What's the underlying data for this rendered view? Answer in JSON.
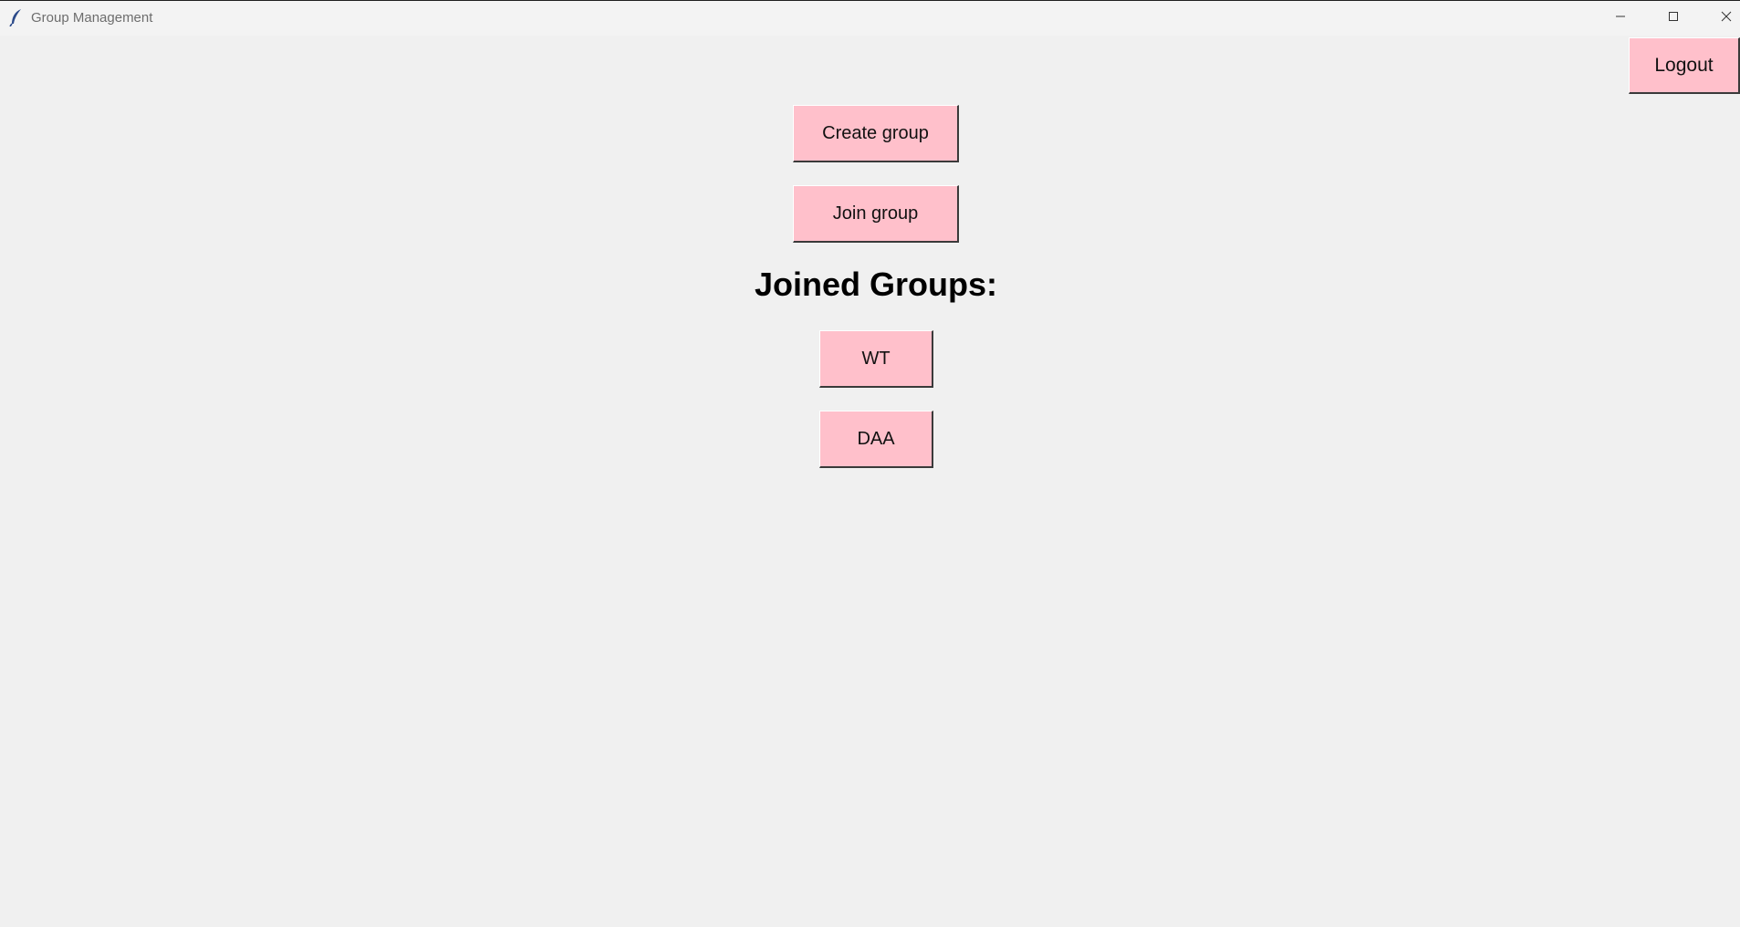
{
  "window": {
    "title": "Group Management",
    "icons": {
      "app": "feather-icon",
      "minimize": "minimize-icon",
      "maximize": "maximize-icon",
      "close": "close-icon"
    }
  },
  "header": {
    "logout_label": "Logout"
  },
  "actions": {
    "create_label": "Create group",
    "join_label": "Join group"
  },
  "joined": {
    "heading": "Joined Groups:",
    "groups": [
      "WT",
      "DAA"
    ]
  },
  "colors": {
    "button_bg": "#ffc0cb",
    "window_bg": "#f0f0f0",
    "heading_text": "#000000"
  }
}
